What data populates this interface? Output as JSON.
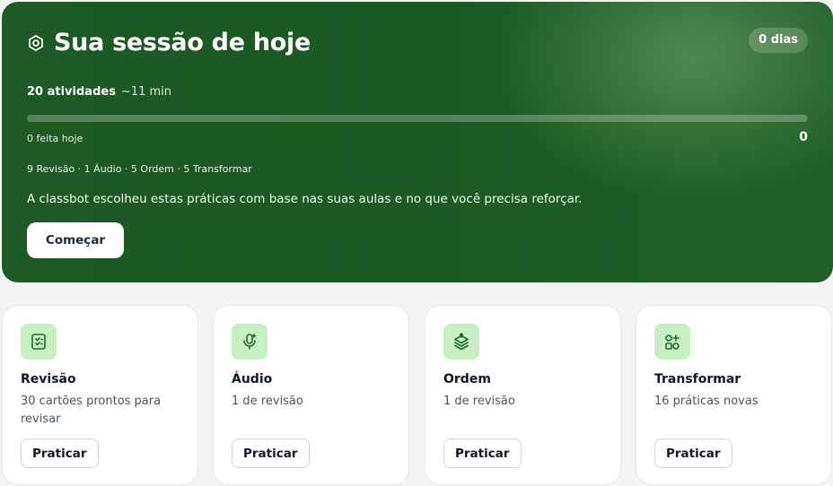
{
  "session": {
    "title": "Sua sessão de hoje",
    "streak": "0 dias",
    "activities": "20 atividades",
    "duration": "~11 min",
    "progress": 0,
    "done_label": "0 feita hoje",
    "done_count": "0",
    "breakdown": "9 Revisão · 1 Áudio · 5 Ordem · 5 Transformar",
    "description": "A classbot escolheu estas práticas com base nas suas aulas e no que você precisa reforçar.",
    "start_label": "Começar"
  },
  "cards": [
    {
      "icon": "checklist-icon",
      "title": "Revisão",
      "subtitle": "30 cartões prontos para revisar",
      "button": "Praticar"
    },
    {
      "icon": "microphone-icon",
      "title": "Áudio",
      "subtitle": "1 de revisão",
      "button": "Praticar"
    },
    {
      "icon": "stack-icon",
      "title": "Ordem",
      "subtitle": "1 de revisão",
      "button": "Praticar"
    },
    {
      "icon": "shapes-icon",
      "title": "Transformar",
      "subtitle": "16 práticas novas",
      "button": "Praticar"
    }
  ],
  "colors": {
    "hero_bg": "#1b5a24",
    "icon_bg": "#c7efc3",
    "icon_fg": "#1f6b2a"
  }
}
